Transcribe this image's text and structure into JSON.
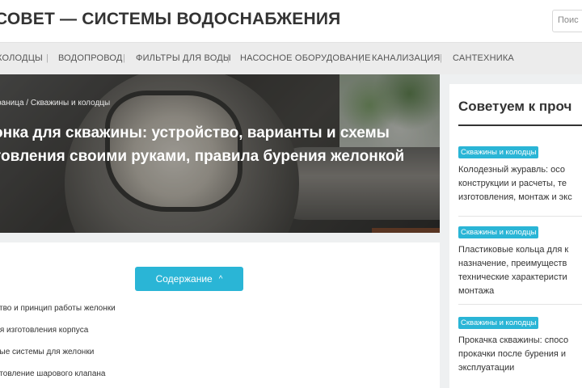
{
  "header": {
    "site_title": "СОВЕТ — СИСТЕМЫ ВОДОСНАБЖЕНИЯ",
    "search_placeholder": "Поис"
  },
  "nav": {
    "items": [
      {
        "label": "КОЛОДЦЫ"
      },
      {
        "label": "ВОДОПРОВОД"
      },
      {
        "label": "ФИЛЬТРЫ ДЛЯ ВОДЫ"
      },
      {
        "label": "НАСОСНОЕ ОБОРУДОВАНИЕ"
      },
      {
        "label": "КАНАЛИЗАЦИЯ"
      },
      {
        "label": "САНТЕХНИКА"
      }
    ],
    "separator": "|"
  },
  "hero": {
    "breadcrumb": "раница / Скважины и колодцы",
    "title": "онка для скважины: устройство, варианты и схемы товления своими руками, правила бурения желонкой"
  },
  "toc": {
    "button_label": "Содержание",
    "chevron": "^",
    "items": [
      {
        "label": "ство и принцип работы желонки"
      },
      {
        "label": "ля изготовления корпуса"
      },
      {
        "label": "ные системы для желонки"
      },
      {
        "label": "отовление шарового клапана"
      }
    ]
  },
  "sidebar": {
    "title": "Советуем к проч",
    "items": [
      {
        "badge": "Скважины и колодцы",
        "lines": [
          "Колодезный журавль: осо",
          "конструкции и расчеты, те",
          "изготовления, монтаж и экс"
        ]
      },
      {
        "badge": "Скважины и колодцы",
        "lines": [
          "Пластиковые кольца для к",
          "назначение, преимуществ",
          "технические характеристи",
          "монтажа"
        ]
      },
      {
        "badge": "Скважины и колодцы",
        "lines": [
          "Прокачка скважины: спосо",
          "прокачки после бурения и",
          "эксплуатации"
        ]
      }
    ]
  },
  "colors": {
    "accent": "#2ab5d6",
    "header_bg": "#ffffff",
    "nav_bg": "#ececec",
    "page_bg": "#eef0f1"
  }
}
